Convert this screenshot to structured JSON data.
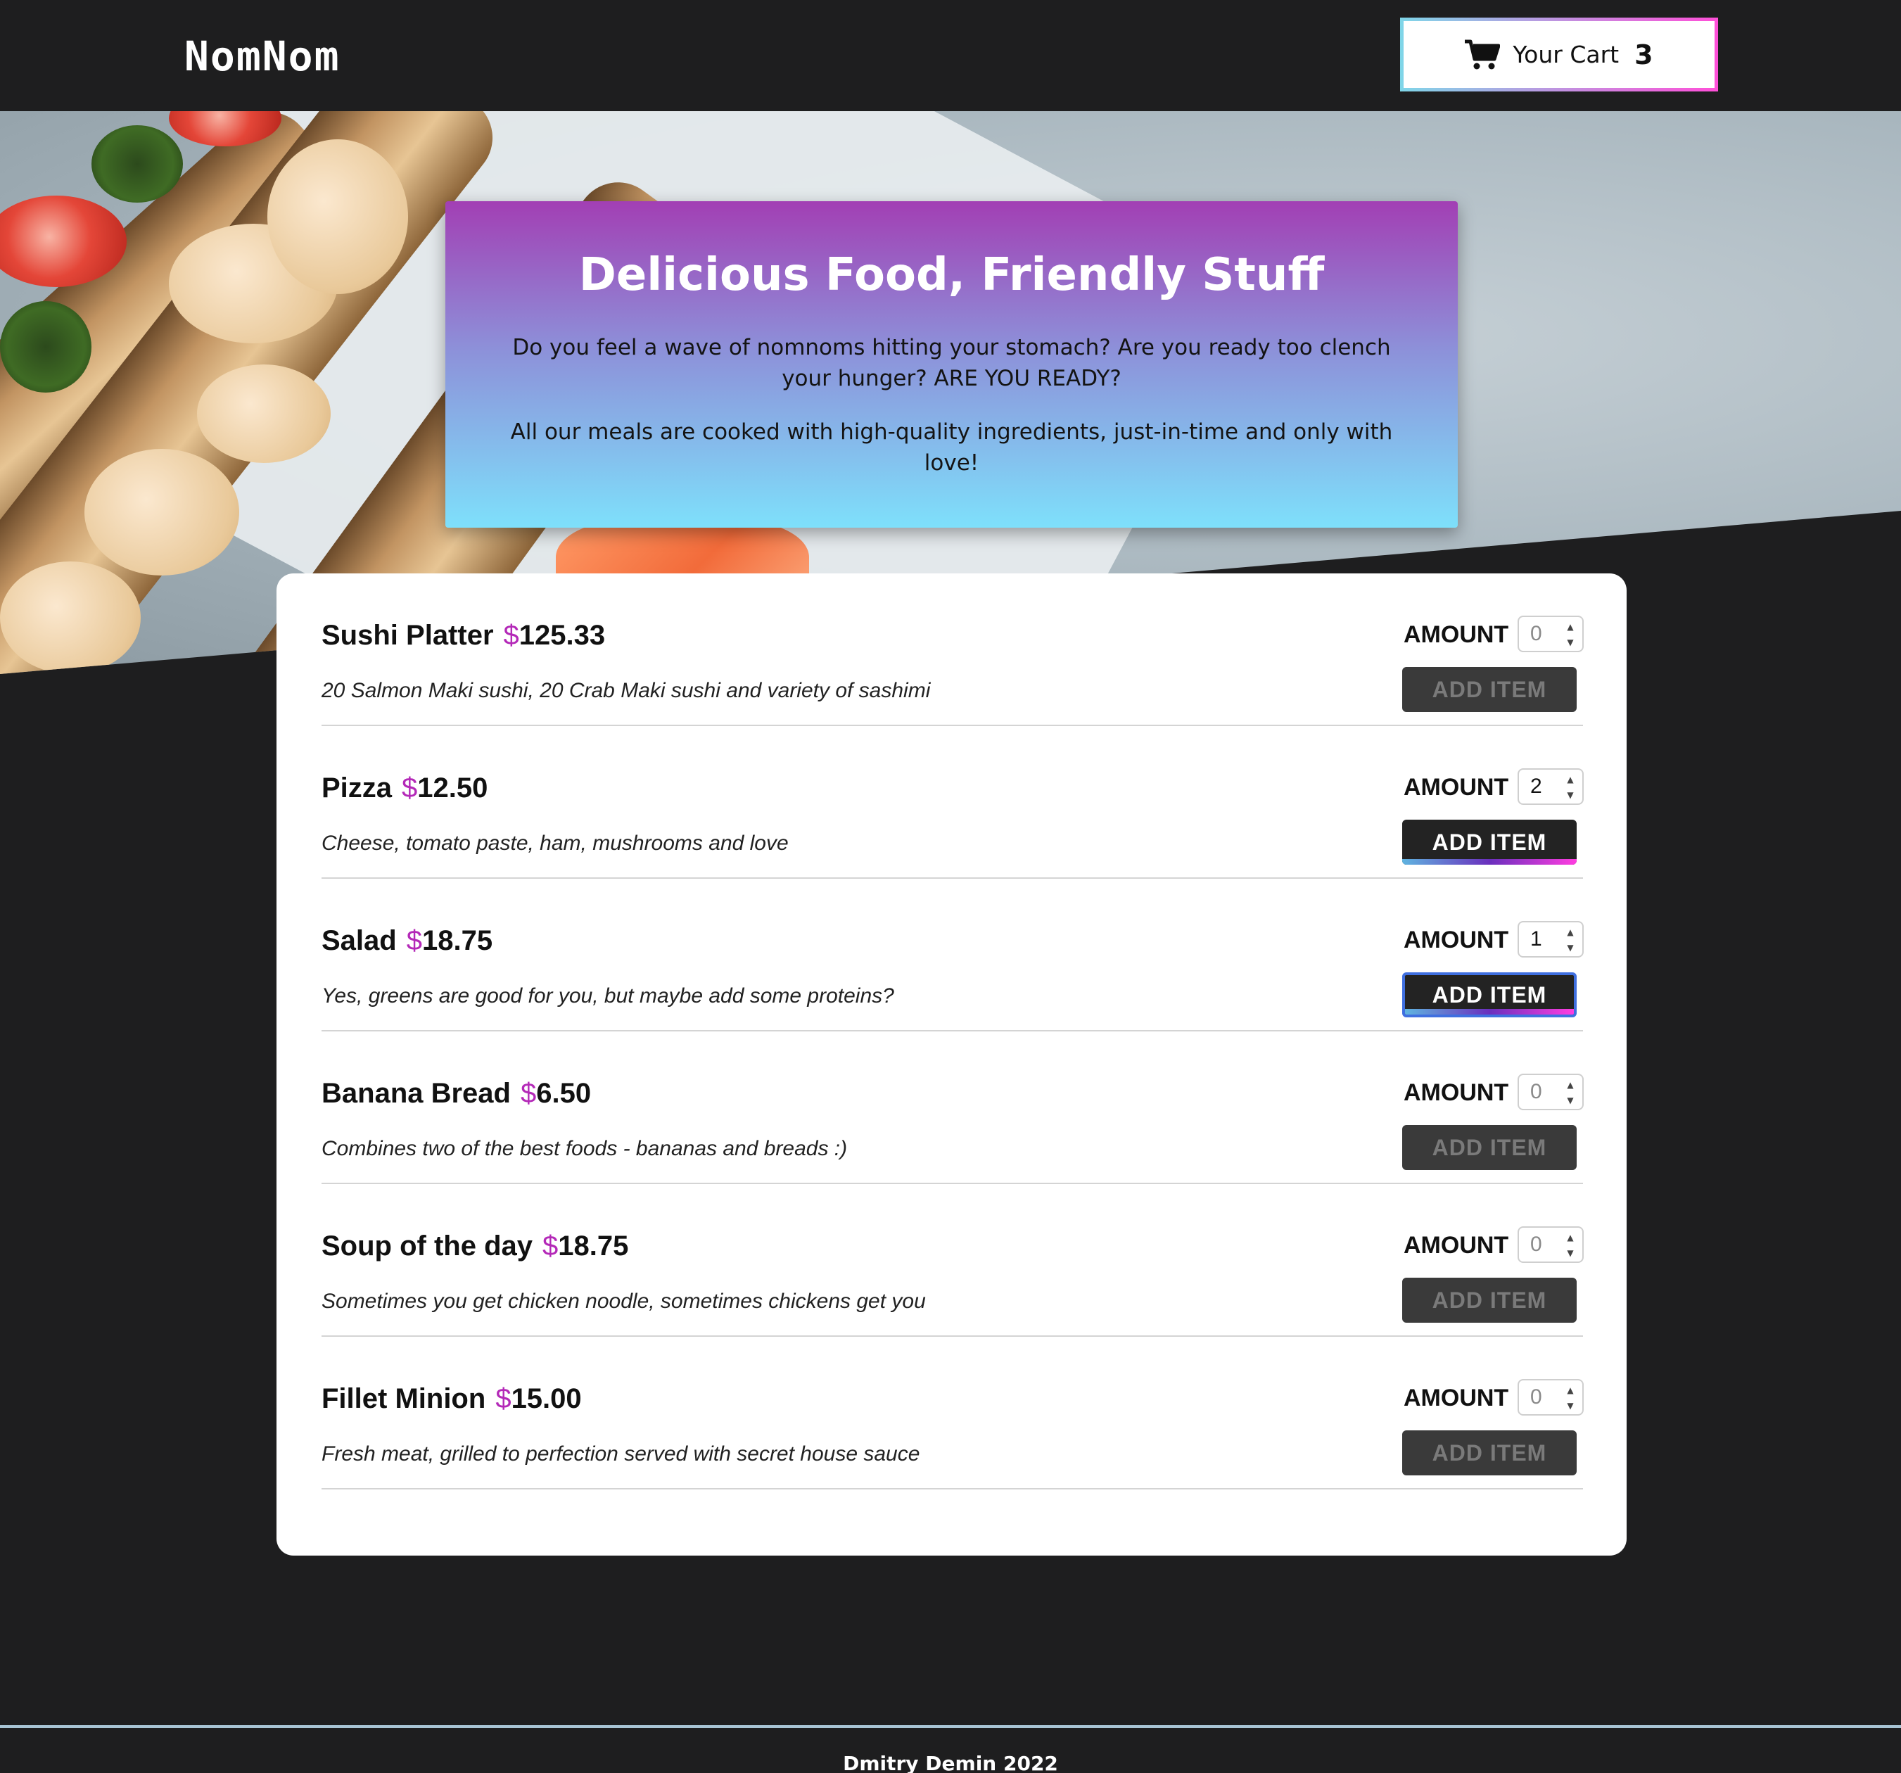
{
  "header": {
    "logo": "NomNom",
    "cart": {
      "label": "Your Cart",
      "count": "3",
      "icon": "cart-icon"
    }
  },
  "hero": {
    "title": "Delicious Food, Friendly Stuff",
    "paragraph1": "Do you feel a wave of nomnoms hitting your stomach? Are you ready too clench your hunger? ARE YOU READY?",
    "paragraph2": "All our meals are cooked with high-quality ingredients, just-in-time and only with love!"
  },
  "menu": {
    "amount_label": "AMOUNT",
    "add_label": "ADD ITEM",
    "currency": "$",
    "items": [
      {
        "name": "Sushi Platter",
        "price": "125.33",
        "description": "20 Salmon Maki sushi, 20 Crab Maki sushi and variety of sashimi",
        "amount": "0"
      },
      {
        "name": "Pizza",
        "price": "12.50",
        "description": "Cheese, tomato paste, ham, mushrooms and love",
        "amount": "2"
      },
      {
        "name": "Salad",
        "price": "18.75",
        "description": "Yes, greens are good for you, but maybe add some proteins?",
        "amount": "1"
      },
      {
        "name": "Banana Bread",
        "price": "6.50",
        "description": "Combines two of the best foods - bananas and breads :)",
        "amount": "0"
      },
      {
        "name": "Soup of the day",
        "price": "18.75",
        "description": "Sometimes you get chicken noodle, sometimes chickens get you",
        "amount": "0"
      },
      {
        "name": "Fillet Minion",
        "price": "15.00",
        "description": "Fresh meat, grilled to perfection served with secret house sauce",
        "amount": "0"
      }
    ]
  },
  "footer": {
    "text": "Dmitry Demin 2022"
  },
  "colors": {
    "accent": "#b429b8",
    "background": "#1e1e1f",
    "focus": "#3f6fe0"
  }
}
